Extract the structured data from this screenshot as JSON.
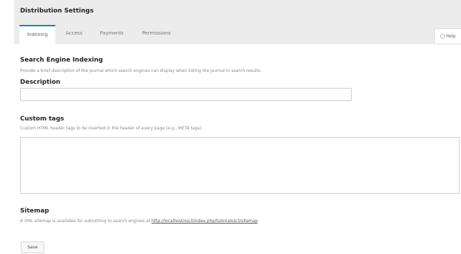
{
  "page": {
    "title": "Distribution Settings"
  },
  "tabs": [
    {
      "label": "Indexing",
      "active": true
    },
    {
      "label": "Access"
    },
    {
      "label": "Payments"
    },
    {
      "label": "Permissions"
    }
  ],
  "help": {
    "label": "Help",
    "icon": "help-circle-icon"
  },
  "indexing": {
    "title": "Search Engine Indexing",
    "description": "Provide a brief description of the journal which search engines can display when listing the journal in search results.",
    "description_field": {
      "label": "Description",
      "value": ""
    }
  },
  "custom_tags": {
    "title": "Custom tags",
    "description": "Custom HTML header tags to be inserted in the header of every page (e.g., META tags).",
    "value": ""
  },
  "sitemap": {
    "title": "Sitemap",
    "text": "A XML sitemap is available for submitting to search engines at",
    "link": "http://localhost/ojs3/index.php/tutorialojs3/sitemap"
  },
  "actions": {
    "save_label": "Save"
  },
  "colors": {
    "accent": "#1f7aa8",
    "header_bg": "#ececec"
  }
}
